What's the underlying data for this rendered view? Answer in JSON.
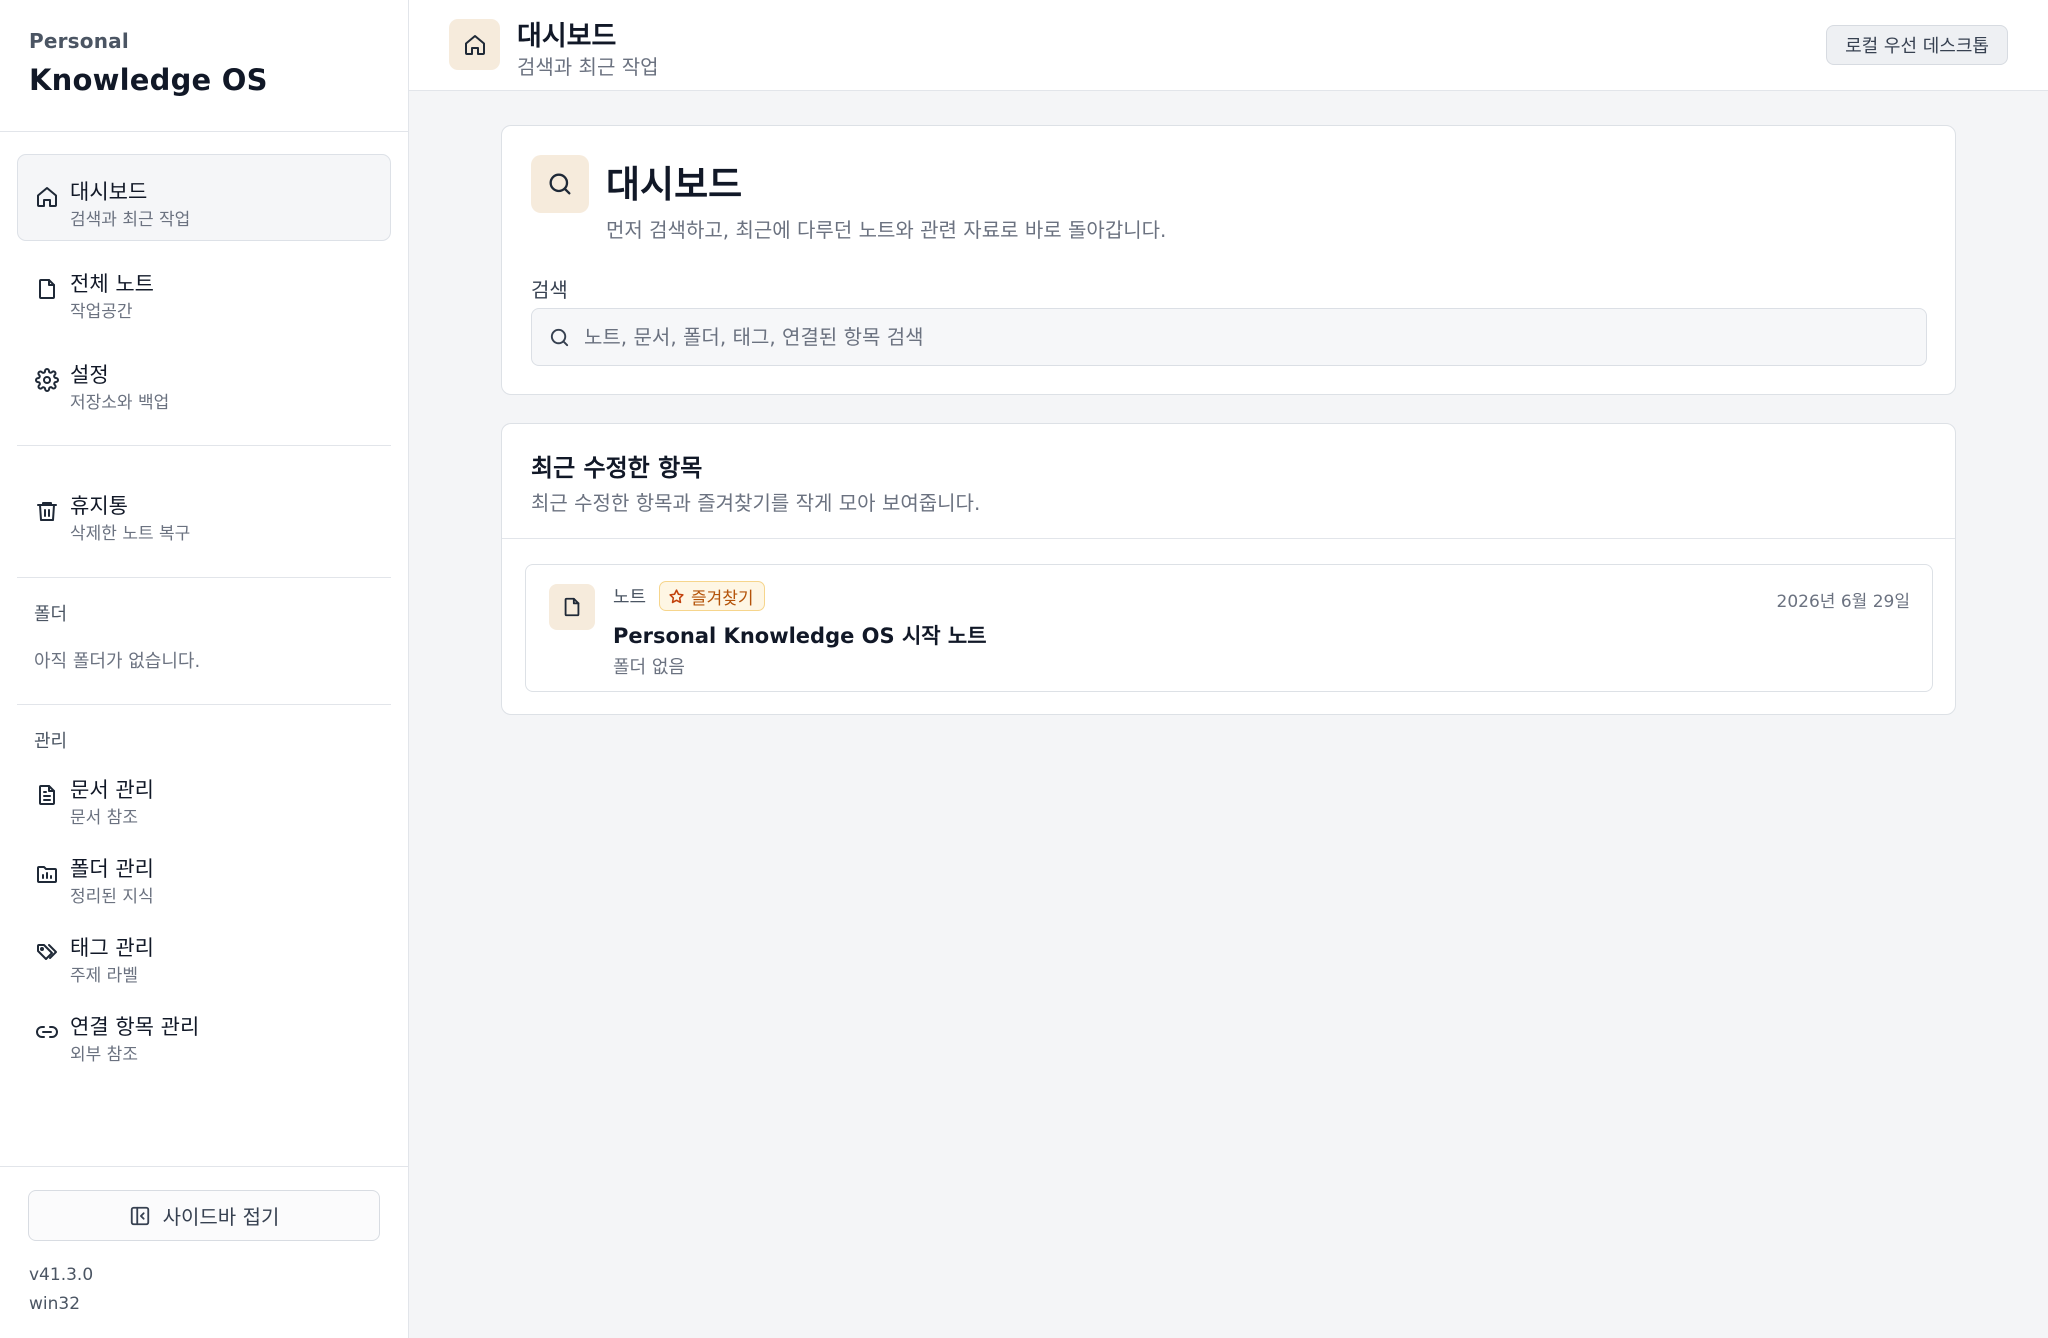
{
  "brand": {
    "sub": "Personal",
    "title": "Knowledge OS"
  },
  "sidebar": {
    "primary": [
      {
        "label": "대시보드",
        "desc": "검색과 최근 작업",
        "icon": "home-icon",
        "active": true
      },
      {
        "label": "전체 노트",
        "desc": "작업공간",
        "icon": "file-icon"
      },
      {
        "label": "설정",
        "desc": "저장소와 백업",
        "icon": "gear-icon"
      }
    ],
    "trash": {
      "label": "휴지통",
      "desc": "삭제한 노트 복구",
      "icon": "trash-icon"
    },
    "folders": {
      "title": "폴더",
      "empty": "아직 폴더가 없습니다."
    },
    "manage": {
      "title": "관리",
      "items": [
        {
          "label": "문서 관리",
          "desc": "문서 참조",
          "icon": "document-icon"
        },
        {
          "label": "폴더 관리",
          "desc": "정리된 지식",
          "icon": "folder-icon"
        },
        {
          "label": "태그 관리",
          "desc": "주제 라벨",
          "icon": "tags-icon"
        },
        {
          "label": "연결 항목 관리",
          "desc": "외부 참조",
          "icon": "link-icon"
        }
      ]
    },
    "collapse_label": "사이드바 접기",
    "version": "v41.3.0",
    "platform": "win32"
  },
  "header": {
    "title": "대시보드",
    "subtitle": "검색과 최근 작업",
    "mode_label": "로컬 우선 데스크톱"
  },
  "search_card": {
    "title": "대시보드",
    "desc": "먼저 검색하고, 최근에 다루던 노트와 관련 자료로 바로 돌아갑니다.",
    "label": "검색",
    "placeholder": "노트, 문서, 폴더, 태그, 연결된 항목 검색",
    "value": ""
  },
  "recent": {
    "title": "최근 수정한 항목",
    "desc": "최근 수정한 항목과 즐겨찾기를 작게 모아 보여줍니다.",
    "items": [
      {
        "kind": "노트",
        "badge": "즐겨찾기",
        "date": "2026년 6월 29일",
        "title": "Personal Knowledge OS 시작 노트",
        "folder": "폴더 없음"
      }
    ]
  },
  "colors": {
    "accent_bg": "#f6ebdc",
    "badge_text": "#b45309",
    "badge_border": "#f6d58c"
  }
}
